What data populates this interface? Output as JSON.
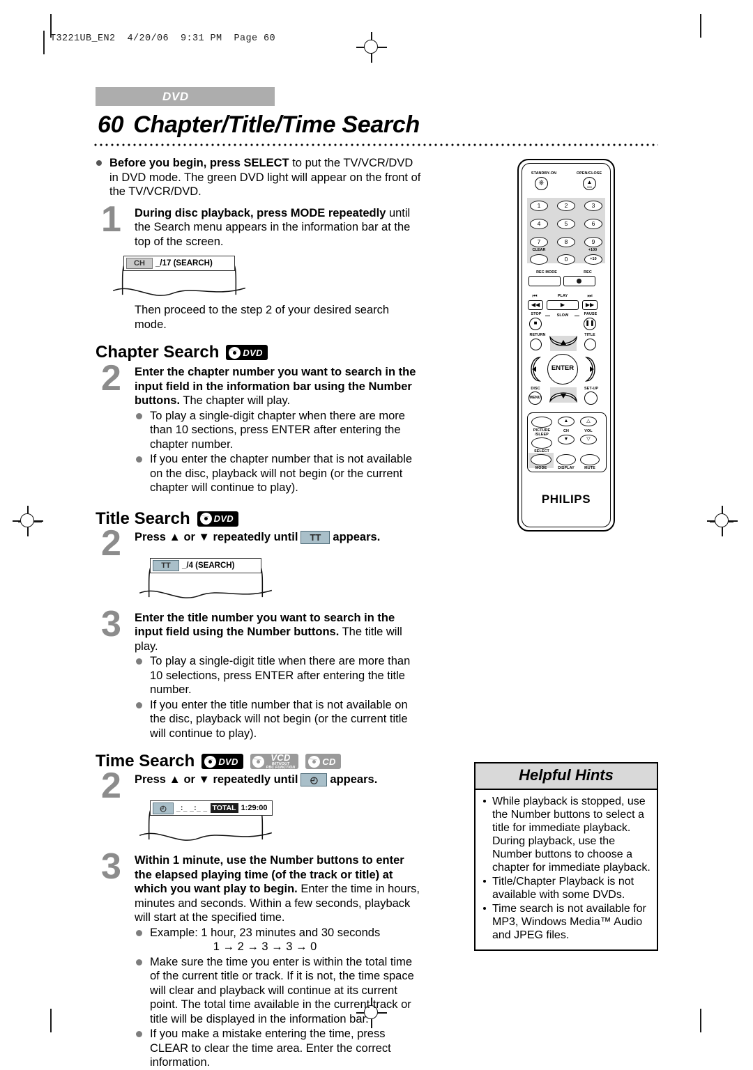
{
  "print_header": "T3221UB_EN2  4/20/06  9:31 PM  Page 60",
  "banner": {
    "label": "DVD"
  },
  "title": {
    "number": "60",
    "text": "Chapter/Title/Time Search"
  },
  "intro": {
    "bold_lead": "Before you begin, press SELECT",
    "rest": " to put the TV/VCR/DVD in DVD mode. The green DVD light will appear on the front of the TV/VCR/DVD."
  },
  "step1": {
    "number": "1",
    "bold": "During disc playback, press MODE repeatedly",
    "rest": " until the Search menu appears in the information bar at the top of the screen.",
    "mock": {
      "tag": "CH",
      "text": "_/17 (SEARCH)"
    },
    "after": "Then proceed to the step 2 of your desired search mode."
  },
  "chapter_search": {
    "heading": "Chapter Search",
    "badges": [
      "DVD"
    ],
    "step2": {
      "number": "2",
      "bold": "Enter the chapter number you want to search in the input field in the information bar using the Number buttons.",
      "rest": " The chapter will play.",
      "bullets": [
        "To play a single-digit chapter when there are more than 10 sections, press ENTER after entering the chapter number.",
        "If you enter the chapter number that is not available on the disc, playback will not begin (or the current chapter will continue to play)."
      ]
    }
  },
  "title_search": {
    "heading": "Title Search",
    "badges": [
      "DVD"
    ],
    "step2": {
      "number": "2",
      "text_before": "Press ▲ or ▼ repeatedly until",
      "inline_box": "TT",
      "text_after": "appears.",
      "mock": {
        "tag": "TT",
        "text": "_/4 (SEARCH)"
      }
    },
    "step3": {
      "number": "3",
      "bold": "Enter the title number you want to search in the input field using the Number buttons.",
      "rest": " The title will play.",
      "bullets": [
        "To play a single-digit title when there are more than 10 selections, press ENTER after entering the title number.",
        "If you enter the title number that is not available on the disc, playback will not begin (or the current title will continue to play)."
      ]
    }
  },
  "time_search": {
    "heading": "Time Search",
    "badges": [
      "DVD",
      "VCD",
      "CD"
    ],
    "vcd_sub1": "WITHOUT",
    "vcd_sub2": "PBC FUNCTION",
    "step2": {
      "number": "2",
      "text_before": "Press ▲ or ▼ repeatedly until",
      "inline_box": "◴",
      "text_after": "appears.",
      "mock": {
        "tag": "◴",
        "digits": "_:_ _:_ _",
        "total_label": "TOTAL",
        "total_value": "1:29:00"
      }
    },
    "step3": {
      "number": "3",
      "bold": "Within 1 minute, use the Number buttons to enter the elapsed playing time (of the track or title) at which you want play to begin.",
      "rest": " Enter the time in hours, minutes and seconds. Within a few seconds, playback will start at the specified time.",
      "bullets": [
        "Example: 1 hour, 23 minutes and 30 seconds",
        "Make sure the time you enter is within the total time of the current title or track.  If it is not, the time space will clear and playback will continue at its current point.  The total time available in the current track or title will be displayed in the information bar.",
        "If you make a mistake entering the time, press CLEAR to clear the time area.  Enter the correct information."
      ],
      "example_sequence": "1 → 2 → 3 → 3 → 0"
    }
  },
  "helpful_hints": {
    "title": "Helpful Hints",
    "items": [
      "While playback is stopped, use the Number buttons to select a title for immediate playback. During playback, use the Number buttons to choose a chapter for immediate playback.",
      "Title/Chapter Playback is not available with some DVDs.",
      "Time search is not available for MP3, Windows Media™ Audio and JPEG files."
    ]
  },
  "remote": {
    "brand": "PHILIPS",
    "standby_label": "STANDBY-ON",
    "open_close_label": "OPEN/CLOSE",
    "numbers": [
      "1",
      "2",
      "3",
      "4",
      "5",
      "6",
      "7",
      "8",
      "9",
      "0"
    ],
    "clear_label": "CLEAR",
    "plus100_label": "+100",
    "plus10_label": "+10",
    "rec_mode_label": "REC MODE",
    "rec_label": "REC",
    "play_label": "PLAY",
    "stop_label": "STOP",
    "slow_label": "SLOW",
    "pause_label": "PAUSE",
    "return_label": "RETURN",
    "title_label": "TITLE",
    "enter_label": "ENTER",
    "disc_label": "DISC",
    "disc_menu_label": "MENU",
    "setup_label": "SET-UP",
    "picture_label": "PICTURE",
    "sleep_label": "/SLEEP",
    "select_label": "SELECT",
    "ch_label": "CH",
    "vol_label": "VOL",
    "mode_label": "MODE",
    "display_label": "DISPLAY",
    "mute_label": "MUTE"
  },
  "colors": {
    "banner_gray": "#adadad",
    "step_number_gray": "#8c8c8c",
    "badge_black": "#000000",
    "badge_gray": "#9a9a9a",
    "tag_blue": "#a9bfc9",
    "hints_header": "#d9d9d9"
  }
}
